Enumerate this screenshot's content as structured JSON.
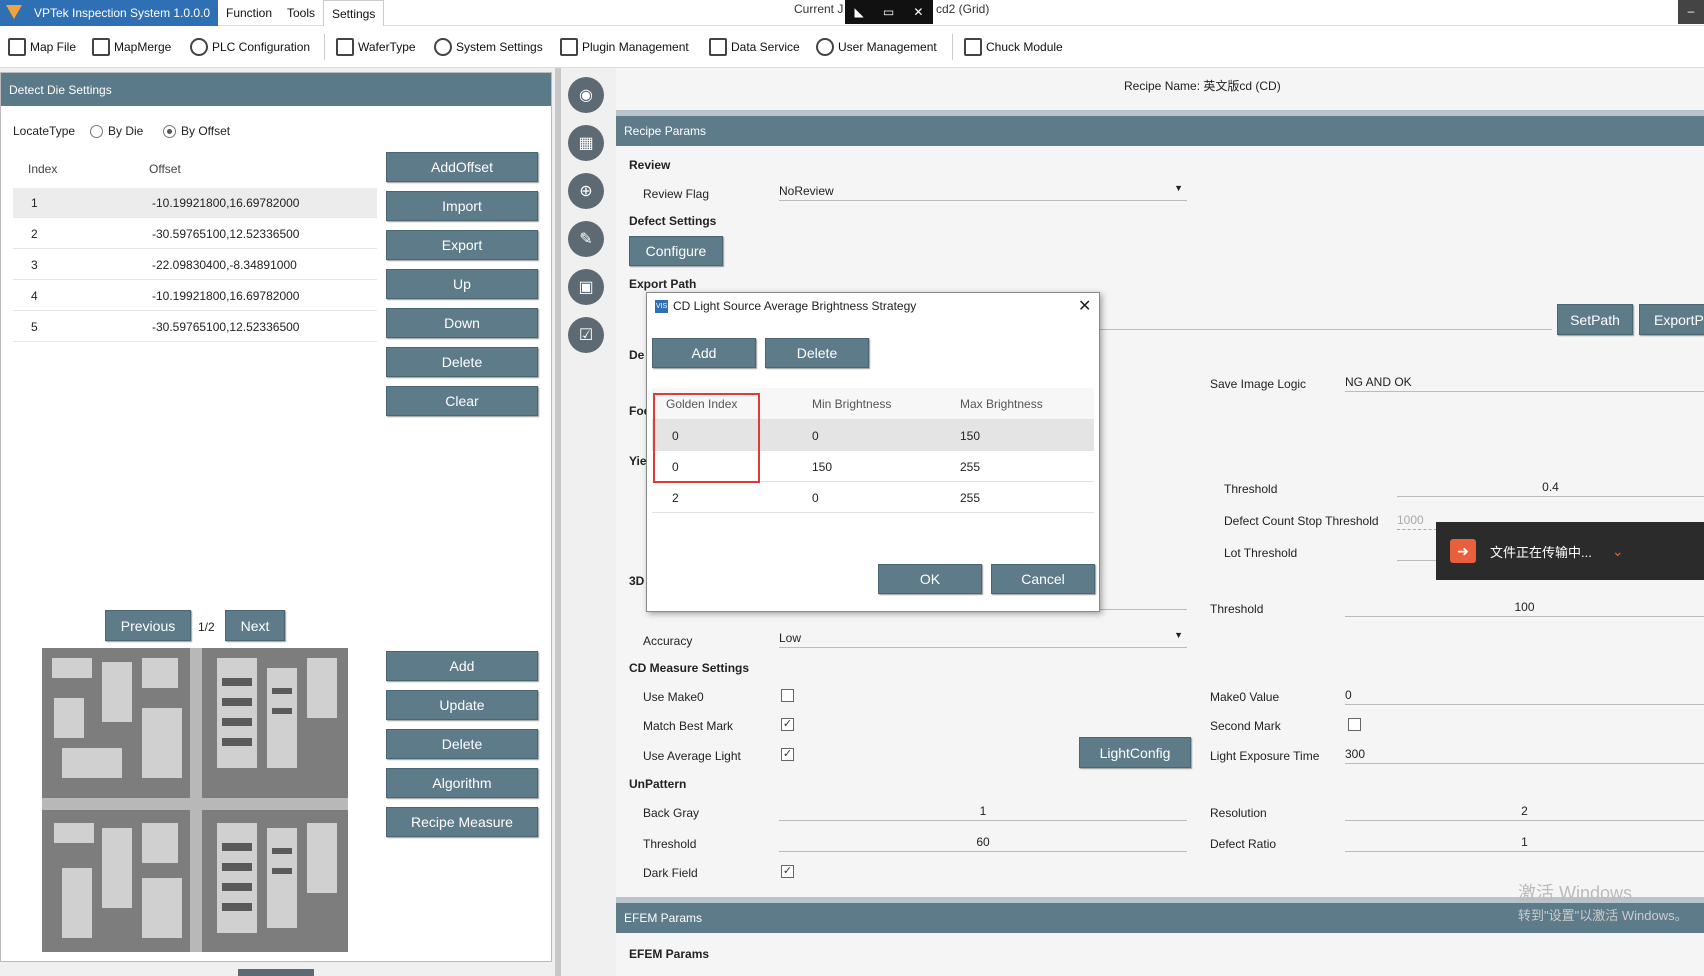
{
  "titlebar": {
    "app_name": "VPTek Inspection System 1.0.0.0",
    "menus": [
      "Function",
      "Tools",
      "Settings"
    ],
    "current_left": "Current J",
    "current_right": "cd2 (Grid)"
  },
  "toolbar": {
    "items": [
      "Map File",
      "MapMerge",
      "PLC Configuration",
      "WaferType",
      "System Settings",
      "Plugin Management",
      "Data Service",
      "User Management",
      "Chuck Module"
    ]
  },
  "left": {
    "header": "Detect Die Settings",
    "locate_label": "LocateType",
    "locate_options": [
      "By Die",
      "By Offset"
    ],
    "locate_selected": "By Offset",
    "table_headers": [
      "Index",
      "Offset"
    ],
    "rows": [
      {
        "index": "1",
        "offset": "-10.19921800,16.69782000"
      },
      {
        "index": "2",
        "offset": "-30.59765100,12.52336500"
      },
      {
        "index": "3",
        "offset": "-22.09830400,-8.34891000"
      },
      {
        "index": "4",
        "offset": "-10.19921800,16.69782000"
      },
      {
        "index": "5",
        "offset": "-30.59765100,12.52336500"
      }
    ],
    "buttons_top": [
      "AddOffset",
      "Import",
      "Export",
      "Up",
      "Down",
      "Delete",
      "Clear"
    ],
    "pager": {
      "prev": "Previous",
      "page": "1/2",
      "next": "Next"
    },
    "buttons_bottom": [
      "Add",
      "Update",
      "Delete",
      "Algorithm",
      "Recipe Measure"
    ]
  },
  "right": {
    "recipe_name": "Recipe Name: 英文版cd (CD)",
    "recipe_params": "Recipe Params",
    "review": "Review",
    "review_flag_label": "Review Flag",
    "review_flag_value": "NoReview",
    "defect_settings": "Defect Settings",
    "configure": "Configure",
    "export_path": "Export Path",
    "setpath": "SetPath",
    "exportp": "ExportP",
    "de_partial": "De",
    "fo_partial": "Foc",
    "yie_partial": "Yie",
    "threed_partial": "3D",
    "save_image_logic_label": "Save Image Logic",
    "save_image_logic_value": "NG AND OK",
    "threshold_label": "Threshold",
    "threshold_value": "0.4",
    "defect_count_stop_label": "Defect Count Stop Threshold",
    "defect_count_stop_value": "1000",
    "lot_threshold_label": "Lot Threshold",
    "threed_threshold_label": "Threshold",
    "threed_threshold_value": "100",
    "accuracy_label": "Accuracy",
    "accuracy_value": "Low",
    "cd_measure": "CD Measure Settings",
    "use_make0": "Use Make0",
    "make0_value_label": "Make0 Value",
    "make0_value": "0",
    "match_best_mark": "Match Best Mark",
    "second_mark": "Second Mark",
    "use_average_light": "Use Average Light",
    "lightconfig": "LightConfig",
    "light_exposure_label": "Light Exposure Time",
    "light_exposure_value": "300",
    "unpattern": "UnPattern",
    "back_gray_label": "Back Gray",
    "back_gray_value": "1",
    "resolution_label": "Resolution",
    "resolution_value": "2",
    "up_threshold_label": "Threshold",
    "up_threshold_value": "60",
    "defect_ratio_label": "Defect Ratio",
    "defect_ratio_value": "1",
    "dark_field": "Dark Field",
    "efem_params_hdr": "EFEM Params",
    "efem_params_sub": "EFEM Params"
  },
  "dialog": {
    "title": "CD Light Source Average Brightness Strategy",
    "add": "Add",
    "delete": "Delete",
    "headers": [
      "Golden Index",
      "Min Brightness",
      "Max Brightness"
    ],
    "rows": [
      {
        "golden": "0",
        "min": "0",
        "max": "150"
      },
      {
        "golden": "0",
        "min": "150",
        "max": "255"
      },
      {
        "golden": "2",
        "min": "0",
        "max": "255"
      }
    ],
    "ok": "OK",
    "cancel": "Cancel"
  },
  "toast": {
    "text": "文件正在传输中..."
  },
  "watermark": {
    "line1": "激活 Windows",
    "line2": "转到\"设置\"以激活 Windows。"
  },
  "colors": {
    "header": "#5d7b89",
    "accent": "#2f6fb3",
    "highlight": "#e03a3a"
  }
}
